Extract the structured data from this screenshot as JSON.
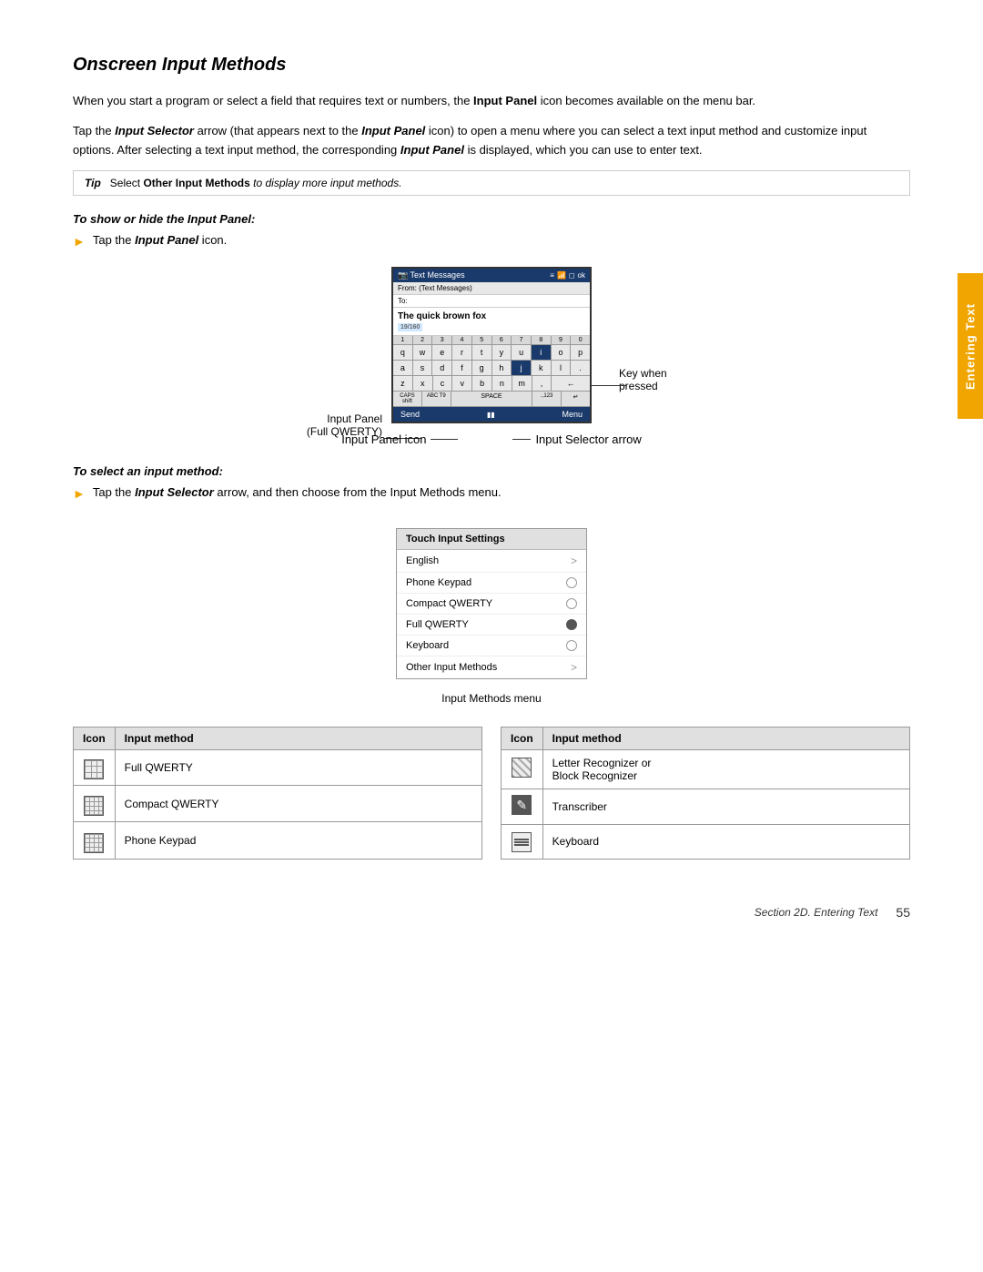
{
  "page": {
    "title": "Onscreen Input Methods",
    "side_tab": "Entering Text",
    "body_text_1": "When you start a program or select a field that requires text or numbers, the Input Panel icon becomes available on the menu bar.",
    "body_text_2": "Tap the Input Selector arrow (that appears next to the Input Panel icon) to open a menu where you can select a text input method and customize input options. After selecting a text input method, the corresponding Input Panel is displayed, which you can use to enter text.",
    "tip": {
      "label": "Tip",
      "text": "Select Other Input Methods to display more input methods."
    },
    "show_hide_heading": "To show or hide the Input Panel:",
    "show_hide_bullet": "Tap the Input Panel icon.",
    "phone_screen": {
      "title": "Text Messages",
      "from_label": "From: (Text Messages)",
      "to_label": "To:",
      "message": "The quick brown fox",
      "counter": "19/160",
      "keys_row1": [
        "q",
        "w",
        "e",
        "r",
        "t",
        "y",
        "u",
        "i",
        "o",
        "p"
      ],
      "keys_row2": [
        "a",
        "s",
        "d",
        "f",
        "g",
        "h",
        "j",
        "k",
        "l",
        "."
      ],
      "keys_row3": [
        "z",
        "x",
        "c",
        "v",
        "b",
        "n",
        "m",
        ",",
        "←"
      ],
      "keys_bottom": [
        "CAPS shift",
        "ABC T9",
        "SPACE",
        ".,123",
        "↵"
      ],
      "taskbar_left": "Send",
      "taskbar_right": "Menu"
    },
    "label_input_panel": "Input Panel\n(Full QWERTY)",
    "label_key_when_pressed": "Key when\npressed",
    "label_input_panel_icon": "Input Panel icon",
    "label_input_selector_arrow": "Input Selector arrow",
    "select_method_heading": "To select an input method:",
    "select_method_bullet": "Tap the Input Selector arrow, and then choose from the Input Methods menu.",
    "menu": {
      "title": "Touch Input Settings",
      "items": [
        {
          "label": "English",
          "type": "arrow"
        },
        {
          "label": "Phone Keypad",
          "type": "radio",
          "selected": false
        },
        {
          "label": "Compact QWERTY",
          "type": "radio",
          "selected": false
        },
        {
          "label": "Full QWERTY",
          "type": "radio",
          "selected": true
        },
        {
          "label": "Keyboard",
          "type": "radio",
          "selected": false
        },
        {
          "label": "Other Input Methods",
          "type": "arrow"
        }
      ],
      "caption": "Input Methods menu"
    },
    "icon_table": {
      "col1_header1": "Icon",
      "col1_header2": "Input method",
      "col2_header1": "Icon",
      "col2_header2": "Input method",
      "rows_left": [
        {
          "method": "Full QWERTY"
        },
        {
          "method": "Compact QWERTY"
        },
        {
          "method": "Phone Keypad"
        }
      ],
      "rows_right": [
        {
          "method": "Letter Recognizer or\nBlock Recognizer"
        },
        {
          "method": "Transcriber"
        },
        {
          "method": "Keyboard"
        }
      ]
    },
    "footer": {
      "section": "Section 2D. Entering Text",
      "page": "55"
    }
  }
}
